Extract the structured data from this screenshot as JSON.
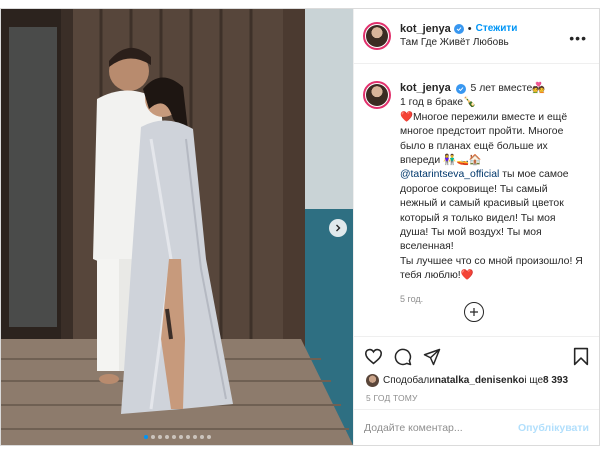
{
  "header": {
    "username": "kot_jenya",
    "separator": "•",
    "follow_label": "Стежити",
    "location": "Там Где Живёт Любовь",
    "more_label": "•••"
  },
  "caption": {
    "username": "kot_jenya",
    "lines": [
      "5 лет вместе💑",
      "1 год в браке🍾",
      "❤️Многое пережили вместе и ещё многое предстоит пройти. Многое было в планах ещё больше их впереди 👫🚤🏠",
      "@tatarintseva_official",
      " ты мое самое дорогое сокровище! Ты самый нежный и самый красивый цветок который я только видел! Ты моя душа! Ты мой воздух! Ты моя вселенная!",
      "Ты лучшее что со мной произошло! Я тебя люблю!❤️"
    ],
    "time": "5 год."
  },
  "likes": {
    "prefix": "Сподобали ",
    "user": "natalka_denisenko",
    "middle": " і ще ",
    "count": "8 393"
  },
  "post_time": "5 ГОД ТОМУ",
  "comment": {
    "placeholder": "Додайте коментар...",
    "publish_label": "Опублікувати"
  },
  "carousel": {
    "total": 10,
    "active": 0
  },
  "colors": {
    "accent": "#0095f6",
    "link": "#00376b",
    "muted": "#8e8e8e",
    "border": "#dbdbdb"
  },
  "icons": [
    "heart-icon",
    "comment-icon",
    "share-icon",
    "bookmark-icon",
    "plus-circle-icon",
    "verified-icon",
    "chevron-right-icon"
  ]
}
